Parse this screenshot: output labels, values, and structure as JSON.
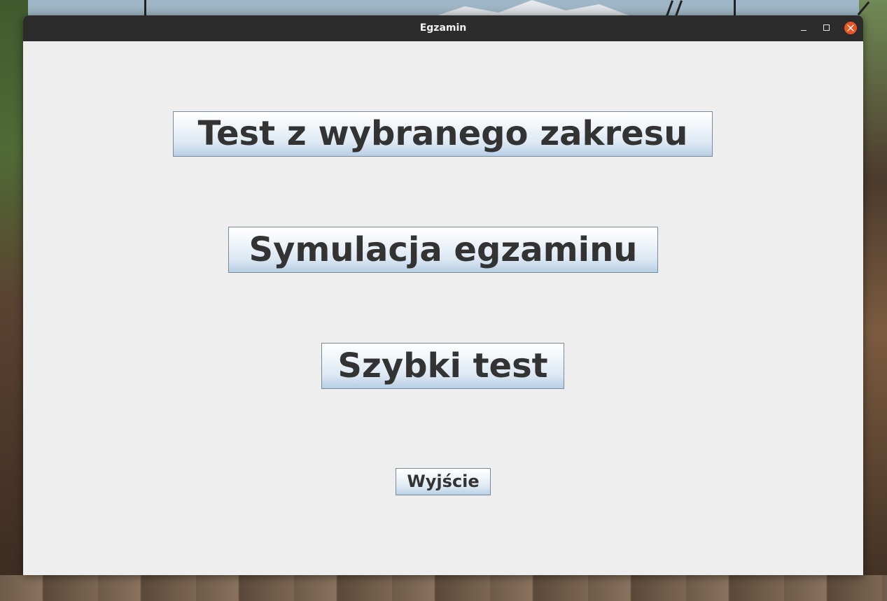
{
  "window": {
    "title": "Egzamin"
  },
  "menu": {
    "range_test_label": "Test z wybranego zakresu",
    "exam_simulation_label": "Symulacja egzaminu",
    "quick_test_label": "Szybki test",
    "exit_label": "Wyjście"
  },
  "colors": {
    "titlebar": "#2c2c2c",
    "close_button": "#e95420",
    "window_background": "#eeeeee",
    "button_text": "#333333"
  },
  "icons": {
    "minimize": "minimize-icon",
    "maximize": "maximize-icon",
    "close": "close-icon"
  }
}
